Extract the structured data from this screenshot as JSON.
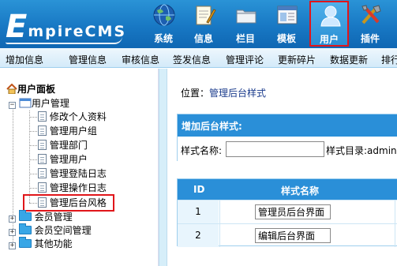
{
  "logo": {
    "first": "E",
    "rest": "mpireCMS"
  },
  "nav": [
    {
      "label": "系统",
      "icon": "globe-icon"
    },
    {
      "label": "信息",
      "icon": "notepad-icon"
    },
    {
      "label": "栏目",
      "icon": "folder-icon"
    },
    {
      "label": "模板",
      "icon": "template-window-icon"
    },
    {
      "label": "用户",
      "icon": "user-icon",
      "active": true
    },
    {
      "label": "插件",
      "icon": "tools-icon"
    }
  ],
  "menubar": [
    "增加信息",
    "管理信息",
    "审核信息",
    "签发信息",
    "管理评论",
    "更新碎片",
    "数据更新",
    "排行"
  ],
  "tree": {
    "root": "用户面板",
    "group": "用户管理",
    "items": [
      "修改个人资料",
      "管理用户组",
      "管理部门",
      "管理用户",
      "管理登陆日志",
      "管理操作日志",
      "管理后台风格"
    ],
    "folders": [
      "会员管理",
      "会员空间管理",
      "其他功能"
    ]
  },
  "location": {
    "prefix": "位置：",
    "link": "管理后台样式"
  },
  "add_form": {
    "title": "增加后台样式:",
    "name_label": "样式名称:",
    "name_value": "",
    "dir_label": "样式目录:adminst"
  },
  "grid": {
    "headers": [
      "ID",
      "样式名称"
    ],
    "rows": [
      {
        "id": "1",
        "name": "管理员后台界面"
      },
      {
        "id": "2",
        "name": "编辑后台界面"
      }
    ]
  },
  "colors": {
    "header": "#1878c4",
    "active_border": "#e0161a",
    "table_header": "#2a8fd8"
  }
}
